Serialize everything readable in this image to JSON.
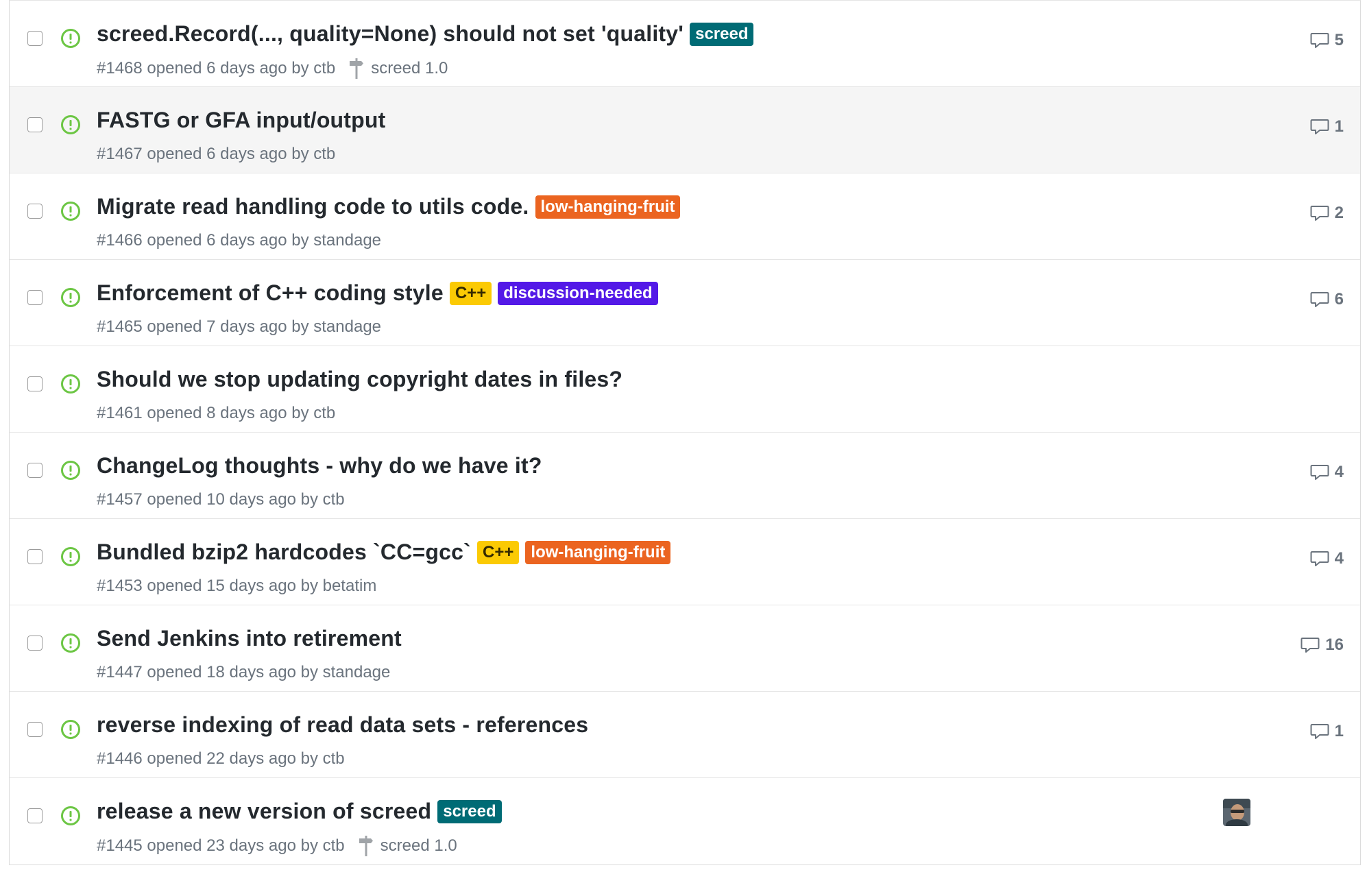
{
  "colors": {
    "open_icon": "#6cc644",
    "label_screed": "#006b75",
    "label_low_hanging_fruit": "#eb6420",
    "label_cpp": "#fbca04",
    "label_discussion_needed": "#5319e7"
  },
  "issues": [
    {
      "title": "screed.Record(..., quality=None) should not set 'quality'",
      "labels": [
        {
          "text": "screed",
          "bg": "#006b75",
          "fg": "#ffffff"
        }
      ],
      "meta": "#1468 opened 6 days ago by ctb",
      "milestone": "screed 1.0",
      "comments": "5"
    },
    {
      "title": "FASTG or GFA input/output",
      "labels": [],
      "meta": "#1467 opened 6 days ago by ctb",
      "milestone": "",
      "comments": "1"
    },
    {
      "title": "Migrate read handling code to utils code.",
      "labels": [
        {
          "text": "low-hanging-fruit",
          "bg": "#eb6420",
          "fg": "#ffffff"
        }
      ],
      "meta": "#1466 opened 6 days ago by standage",
      "milestone": "",
      "comments": "2"
    },
    {
      "title": "Enforcement of C++ coding style",
      "labels": [
        {
          "text": "C++",
          "bg": "#fbca04",
          "fg": "#332900"
        },
        {
          "text": "discussion-needed",
          "bg": "#5319e7",
          "fg": "#ffffff"
        }
      ],
      "meta": "#1465 opened 7 days ago by standage",
      "milestone": "",
      "comments": "6"
    },
    {
      "title": "Should we stop updating copyright dates in files?",
      "labels": [],
      "meta": "#1461 opened 8 days ago by ctb",
      "milestone": "",
      "comments": ""
    },
    {
      "title": "ChangeLog thoughts - why do we have it?",
      "labels": [],
      "meta": "#1457 opened 10 days ago by ctb",
      "milestone": "",
      "comments": "4"
    },
    {
      "title": "Bundled bzip2 hardcodes `CC=gcc`",
      "labels": [
        {
          "text": "C++",
          "bg": "#fbca04",
          "fg": "#332900"
        },
        {
          "text": "low-hanging-fruit",
          "bg": "#eb6420",
          "fg": "#ffffff"
        }
      ],
      "meta": "#1453 opened 15 days ago by betatim",
      "milestone": "",
      "comments": "4"
    },
    {
      "title": "Send Jenkins into retirement",
      "labels": [],
      "meta": "#1447 opened 18 days ago by standage",
      "milestone": "",
      "comments": "16"
    },
    {
      "title": "reverse indexing of read data sets - references",
      "labels": [],
      "meta": "#1446 opened 22 days ago by ctb",
      "milestone": "",
      "comments": "1"
    },
    {
      "title": "release a new version of screed",
      "labels": [
        {
          "text": "screed",
          "bg": "#006b75",
          "fg": "#ffffff"
        }
      ],
      "meta": "#1445 opened 23 days ago by ctb",
      "milestone": "screed 1.0",
      "comments": "",
      "assignee_avatar": true
    }
  ]
}
